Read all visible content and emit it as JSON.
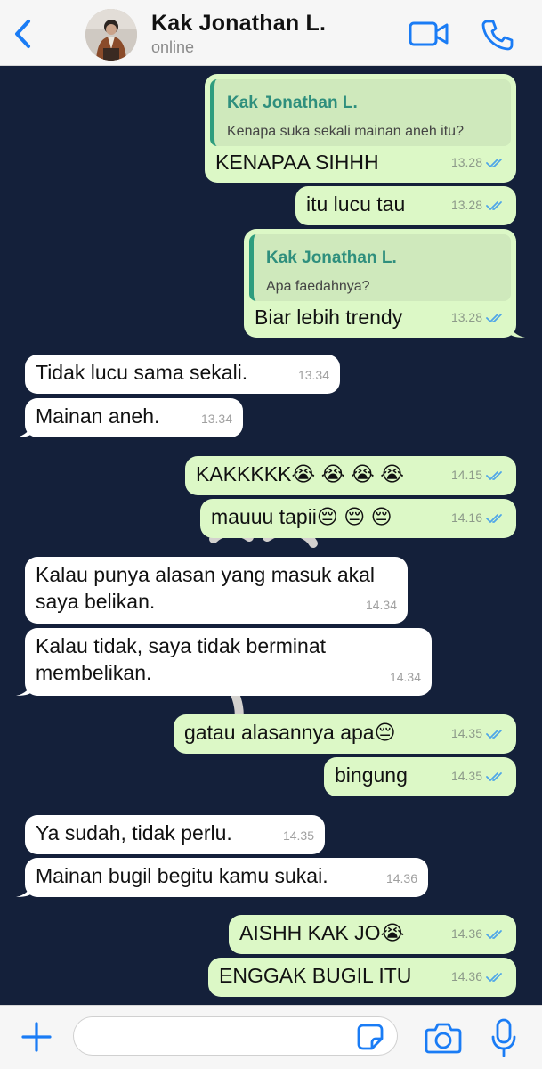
{
  "header": {
    "contact_name": "Kak Jonathan L.",
    "status": "online",
    "icons": {
      "back": "chevron-left-icon",
      "video": "video-camera-icon",
      "phone": "phone-icon"
    }
  },
  "colors": {
    "accent": "#1a7cf5",
    "outgoing_bubble": "#dcf8c6",
    "incoming_bubble": "#ffffff",
    "quote_name": "#2f8f7d",
    "read_ticks": "#4fa6e8",
    "chat_background": "#14203a"
  },
  "messages": [
    {
      "dir": "out",
      "quote": {
        "name": "Kak Jonathan L.",
        "text": "Kenapa suka sekali mainan aneh itu?"
      },
      "text": "KENAPAA SIHHH",
      "time": "13.28",
      "read": true
    },
    {
      "dir": "out",
      "text": "itu lucu tau",
      "time": "13.28",
      "read": true
    },
    {
      "dir": "out",
      "quote": {
        "name": "Kak Jonathan L.",
        "text": "Apa faedahnya?"
      },
      "text": "Biar lebih trendy",
      "time": "13.28",
      "read": true
    },
    {
      "dir": "in",
      "text": "Tidak lucu sama sekali.",
      "time": "13.34"
    },
    {
      "dir": "in",
      "text": "Mainan aneh.",
      "time": "13.34"
    },
    {
      "dir": "out",
      "text": "KAKKKKK😭 😭 😭 😭",
      "time": "14.15",
      "read": true
    },
    {
      "dir": "out",
      "text": "mauuu tapii😔 😔 😔",
      "time": "14.16",
      "read": true
    },
    {
      "dir": "in",
      "text": "Kalau punya alasan yang masuk akal\nsaya belikan.",
      "time": "14.34"
    },
    {
      "dir": "in",
      "text": "Kalau tidak, saya tidak berminat\nmembelikan.",
      "time": "14.34"
    },
    {
      "dir": "out",
      "text": "gatau alasannya apa😔",
      "time": "14.35",
      "read": true
    },
    {
      "dir": "out",
      "text": "bingung",
      "time": "14.35",
      "read": true
    },
    {
      "dir": "in",
      "text": "Ya sudah, tidak perlu.",
      "time": "14.35"
    },
    {
      "dir": "in",
      "text": "Mainan bugil begitu kamu sukai.",
      "time": "14.36"
    },
    {
      "dir": "out",
      "text": "AISHH KAK JO😭",
      "time": "14.36",
      "read": true
    },
    {
      "dir": "out",
      "text": "ENGGAK BUGIL ITU",
      "time": "14.36",
      "read": true
    }
  ],
  "footer": {
    "input_value": "",
    "input_placeholder": "",
    "icons": {
      "add": "plus-icon",
      "sticker": "sticker-icon",
      "camera": "camera-icon",
      "mic": "microphone-icon"
    }
  }
}
